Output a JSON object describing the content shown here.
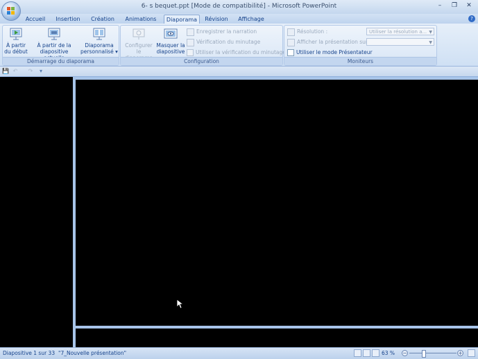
{
  "window": {
    "title": "6- s bequet.ppt [Mode de compatibilité] - Microsoft PowerPoint",
    "min_label": "–",
    "max_label": "❐",
    "close_label": "✕"
  },
  "tabs": [
    {
      "label": "Accueil",
      "active": false
    },
    {
      "label": "Insertion",
      "active": false
    },
    {
      "label": "Création",
      "active": false
    },
    {
      "label": "Animations",
      "active": false
    },
    {
      "label": "Diaporama",
      "active": true
    },
    {
      "label": "Révision",
      "active": false
    },
    {
      "label": "Affichage",
      "active": false
    }
  ],
  "help_label": "?",
  "ribbon": {
    "start_group": {
      "label": "Démarrage du diaporama",
      "from_start": {
        "line1": "À partir",
        "line2": "du début"
      },
      "from_current": {
        "line1": "À partir de la",
        "line2": "diapositive actuelle"
      },
      "custom_show": {
        "line1": "Diaporama",
        "line2": "personnalisé ▾"
      }
    },
    "config_group": {
      "label": "Configuration",
      "setup": {
        "line1": "Configurer",
        "line2": "le diaporama"
      },
      "hide_slide": {
        "line1": "Masquer la",
        "line2": "diapositive"
      },
      "record_narration": "Enregistrer la narration",
      "rehearse_timings": "Vérification du minutage",
      "use_timings": "Utiliser la vérification du minutage"
    },
    "monitors_group": {
      "label": "Moniteurs",
      "resolution_label": "Résolution :",
      "resolution_value": "Utiliser la résolution a...",
      "show_on_label": "Afficher la présentation sur :",
      "show_on_value": "",
      "presenter_view": "Utiliser le mode Présentateur"
    }
  },
  "qat": {
    "save": "💾",
    "undo": "↶",
    "redo": "↷",
    "more": "▾"
  },
  "status": {
    "slide_info": "Diapositive 1 sur 33",
    "theme": "\"7_Nouvelle présentation\"",
    "zoom": "63 %",
    "zoom_level_percent": 63
  },
  "colors": {
    "accent": "#15428b",
    "ribbon_bg": "#dbe7f6",
    "splitter": "#a7c4e9"
  }
}
